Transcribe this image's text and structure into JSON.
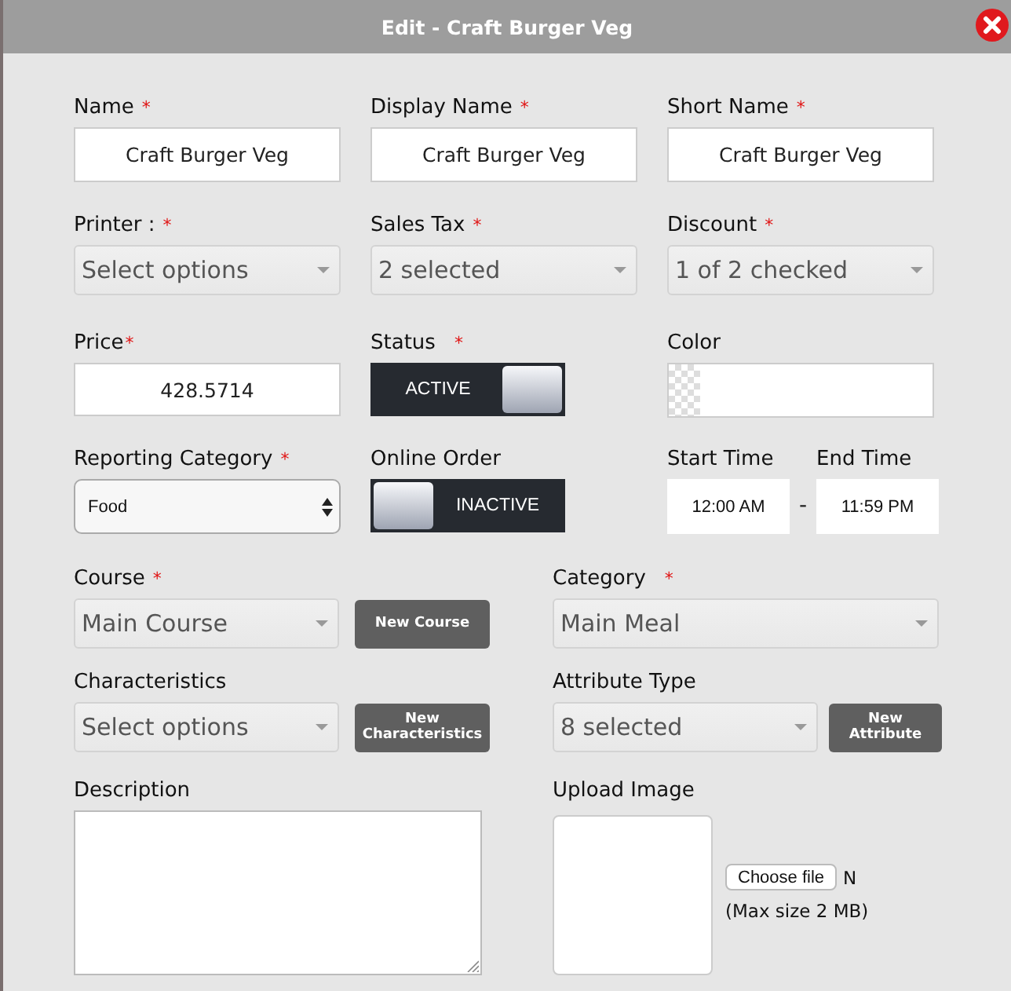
{
  "window": {
    "title": "Edit - Craft Burger Veg"
  },
  "names": [
    {
      "label": "Name",
      "required_mark": "*",
      "value": "Craft Burger Veg"
    },
    {
      "label": "Display Name",
      "required_mark": "*",
      "value": "Craft Burger Veg"
    },
    {
      "label": "Short Name",
      "required_mark": "*",
      "value": "Craft Burger Veg"
    }
  ],
  "selects": [
    {
      "label": "Printer :",
      "required_mark": "*",
      "value": "Select options"
    },
    {
      "label": "Sales Tax",
      "required_mark": "*",
      "value": "2 selected"
    },
    {
      "label": "Discount",
      "required_mark": "*",
      "value": "1 of 2 checked"
    }
  ],
  "price": {
    "label": "Price",
    "required_mark": "*",
    "value": "428.5714"
  },
  "status": {
    "label": "Status",
    "required_mark": "*",
    "on": true,
    "text": "ACTIVE"
  },
  "color": {
    "label": "Color"
  },
  "reporting_category": {
    "label": "Reporting Category",
    "required_mark": "*",
    "value": "Food"
  },
  "online_order": {
    "label": "Online Order",
    "on": false,
    "text": "INACTIVE"
  },
  "start_time": {
    "label": "Start Time",
    "value": "12:00 AM"
  },
  "time_separator": "-",
  "end_time": {
    "label": "End Time",
    "value": "11:59 PM"
  },
  "pickers": [
    {
      "label": "Course",
      "required_mark": "*",
      "value": "Main Course",
      "button": "New Course"
    },
    {
      "label": "Category",
      "required_mark": "*",
      "value": "Main Meal"
    },
    {
      "label": "Characteristics",
      "value": "Select options",
      "button": "New Characteristics"
    },
    {
      "label": "Attribute Type",
      "value": "8 selected",
      "button": "New Attribute"
    }
  ],
  "description": {
    "label": "Description"
  },
  "upload_image": {
    "label": "Upload Image",
    "button": "Choose file",
    "file_name": "N",
    "note": "(Max size 2 MB)"
  }
}
